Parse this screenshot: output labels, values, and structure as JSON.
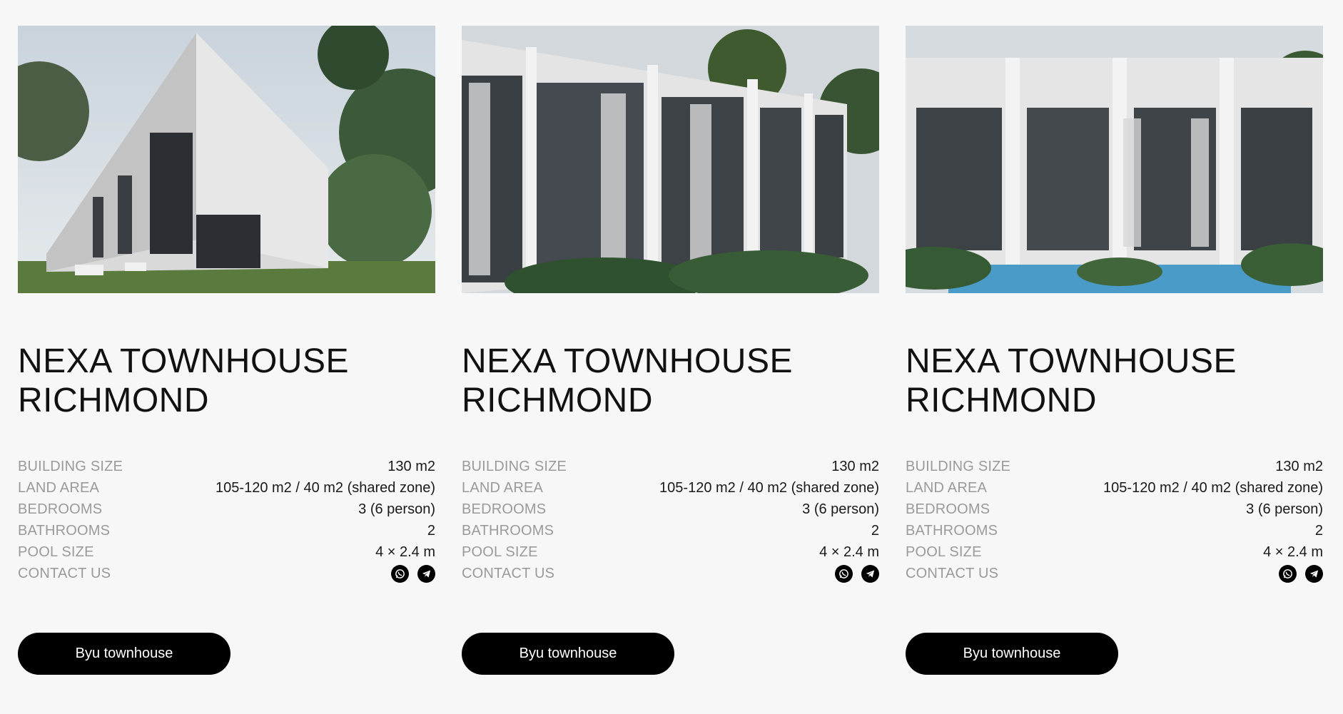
{
  "cards": [
    {
      "title_line1": "NEXA TOWNHOUSE",
      "title_line2": "RICHMOND",
      "specs": [
        {
          "label": "BUILDING SIZE",
          "value": "130 m2"
        },
        {
          "label": "LAND AREA",
          "value": "105-120 m2 / 40 m2 (shared zone)"
        },
        {
          "label": "BEDROOMS",
          "value": "3 (6 person)"
        },
        {
          "label": "BATHROOMS",
          "value": "2"
        },
        {
          "label": "POOL SIZE",
          "value": "4 × 2.4 m"
        }
      ],
      "contact_label": "CONTACT US",
      "button_label": "Byu townhouse"
    },
    {
      "title_line1": "NEXA TOWNHOUSE",
      "title_line2": "RICHMOND",
      "specs": [
        {
          "label": "BUILDING SIZE",
          "value": "130 m2"
        },
        {
          "label": "LAND AREA",
          "value": "105-120 m2 / 40 m2 (shared zone)"
        },
        {
          "label": "BEDROOMS",
          "value": "3 (6 person)"
        },
        {
          "label": "BATHROOMS",
          "value": "2"
        },
        {
          "label": "POOL SIZE",
          "value": "4 × 2.4 m"
        }
      ],
      "contact_label": "CONTACT US",
      "button_label": "Byu townhouse"
    },
    {
      "title_line1": "NEXA TOWNHOUSE",
      "title_line2": "RICHMOND",
      "specs": [
        {
          "label": "BUILDING SIZE",
          "value": "130 m2"
        },
        {
          "label": "LAND AREA",
          "value": "105-120 m2 / 40 m2 (shared zone)"
        },
        {
          "label": "BEDROOMS",
          "value": "3 (6 person)"
        },
        {
          "label": "BATHROOMS",
          "value": "2"
        },
        {
          "label": "POOL SIZE",
          "value": "4 × 2.4 m"
        }
      ],
      "contact_label": "CONTACT US",
      "button_label": "Byu townhouse"
    }
  ],
  "icons": {
    "whatsapp": "whatsapp-icon",
    "telegram": "telegram-icon"
  },
  "colors": {
    "background": "#f7f7f7",
    "button": "#000000",
    "button_text": "#ffffff",
    "label": "#9a9a9a"
  }
}
